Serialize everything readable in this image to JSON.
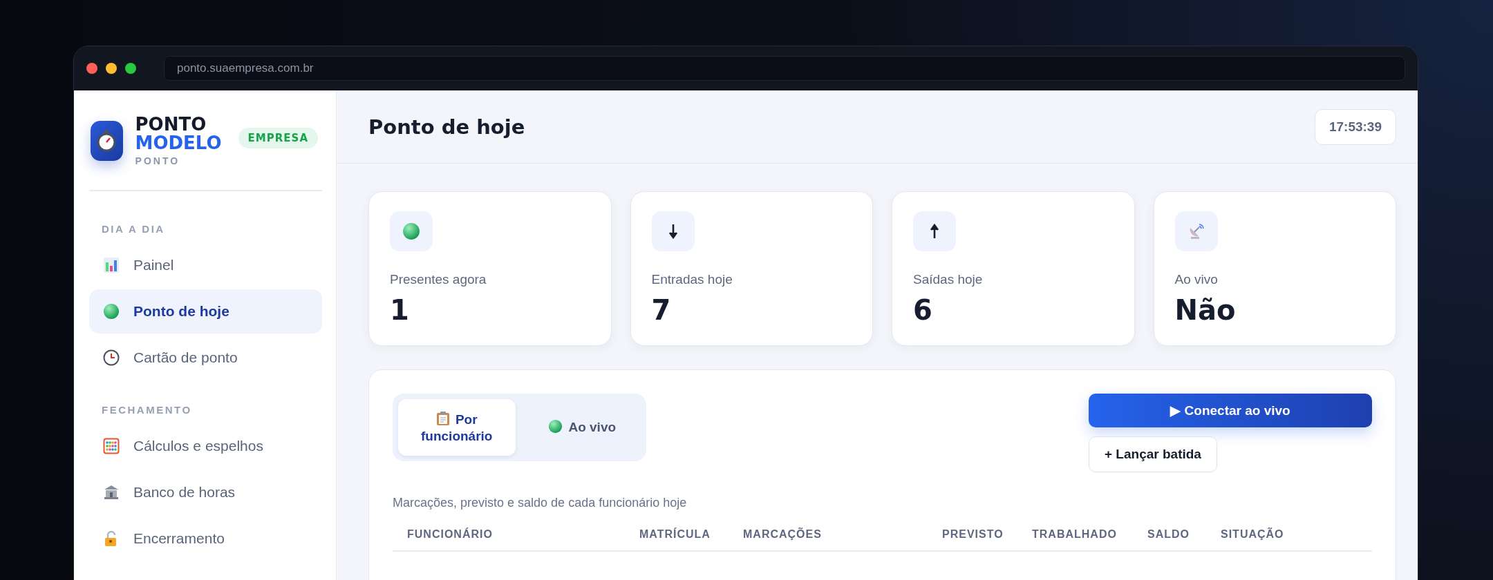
{
  "browser": {
    "url": "ponto.suaempresa.com.br"
  },
  "brand": {
    "line1": "PONTO",
    "line2": "MODELO",
    "subtitle": "PONTO",
    "badge": "EMPRESA"
  },
  "sidebar": {
    "sections": [
      {
        "title": "DIA A DIA",
        "items": [
          {
            "label": "Painel",
            "kind": "chart",
            "selected": false
          },
          {
            "label": "Ponto de hoje",
            "kind": "dot",
            "selected": true
          },
          {
            "label": "Cartão de ponto",
            "kind": "clock",
            "selected": false
          }
        ]
      },
      {
        "title": "FECHAMENTO",
        "items": [
          {
            "label": "Cálculos e espelhos",
            "kind": "abacus",
            "selected": false
          },
          {
            "label": "Banco de horas",
            "kind": "bank",
            "selected": false
          },
          {
            "label": "Encerramento",
            "kind": "lock",
            "selected": false
          }
        ]
      }
    ]
  },
  "header": {
    "title": "Ponto de hoje",
    "clock": "17:53:39"
  },
  "stats": [
    {
      "kind": "dot",
      "label": "Presentes agora",
      "value": "1"
    },
    {
      "kind": "down",
      "label": "Entradas hoje",
      "value": "7"
    },
    {
      "kind": "up",
      "label": "Saídas hoje",
      "value": "6"
    },
    {
      "kind": "satellite",
      "label": "Ao vivo",
      "value": "Não"
    }
  ],
  "panel": {
    "tabs": [
      {
        "label": "Por funcionário",
        "kind": "clipboard",
        "selected": true
      },
      {
        "label": "Ao vivo",
        "kind": "dot",
        "selected": false
      }
    ],
    "primary_button": "▶ Conectar ao vivo",
    "secondary_button": "+ Lançar batida",
    "description": "Marcações, previsto e saldo de cada funcionário hoje",
    "table": {
      "columns": [
        "FUNCIONÁRIO",
        "MATRÍCULA",
        "MARCAÇÕES",
        "PREVISTO",
        "TRABALHADO",
        "SALDO",
        "SITUAÇÃO"
      ]
    }
  }
}
